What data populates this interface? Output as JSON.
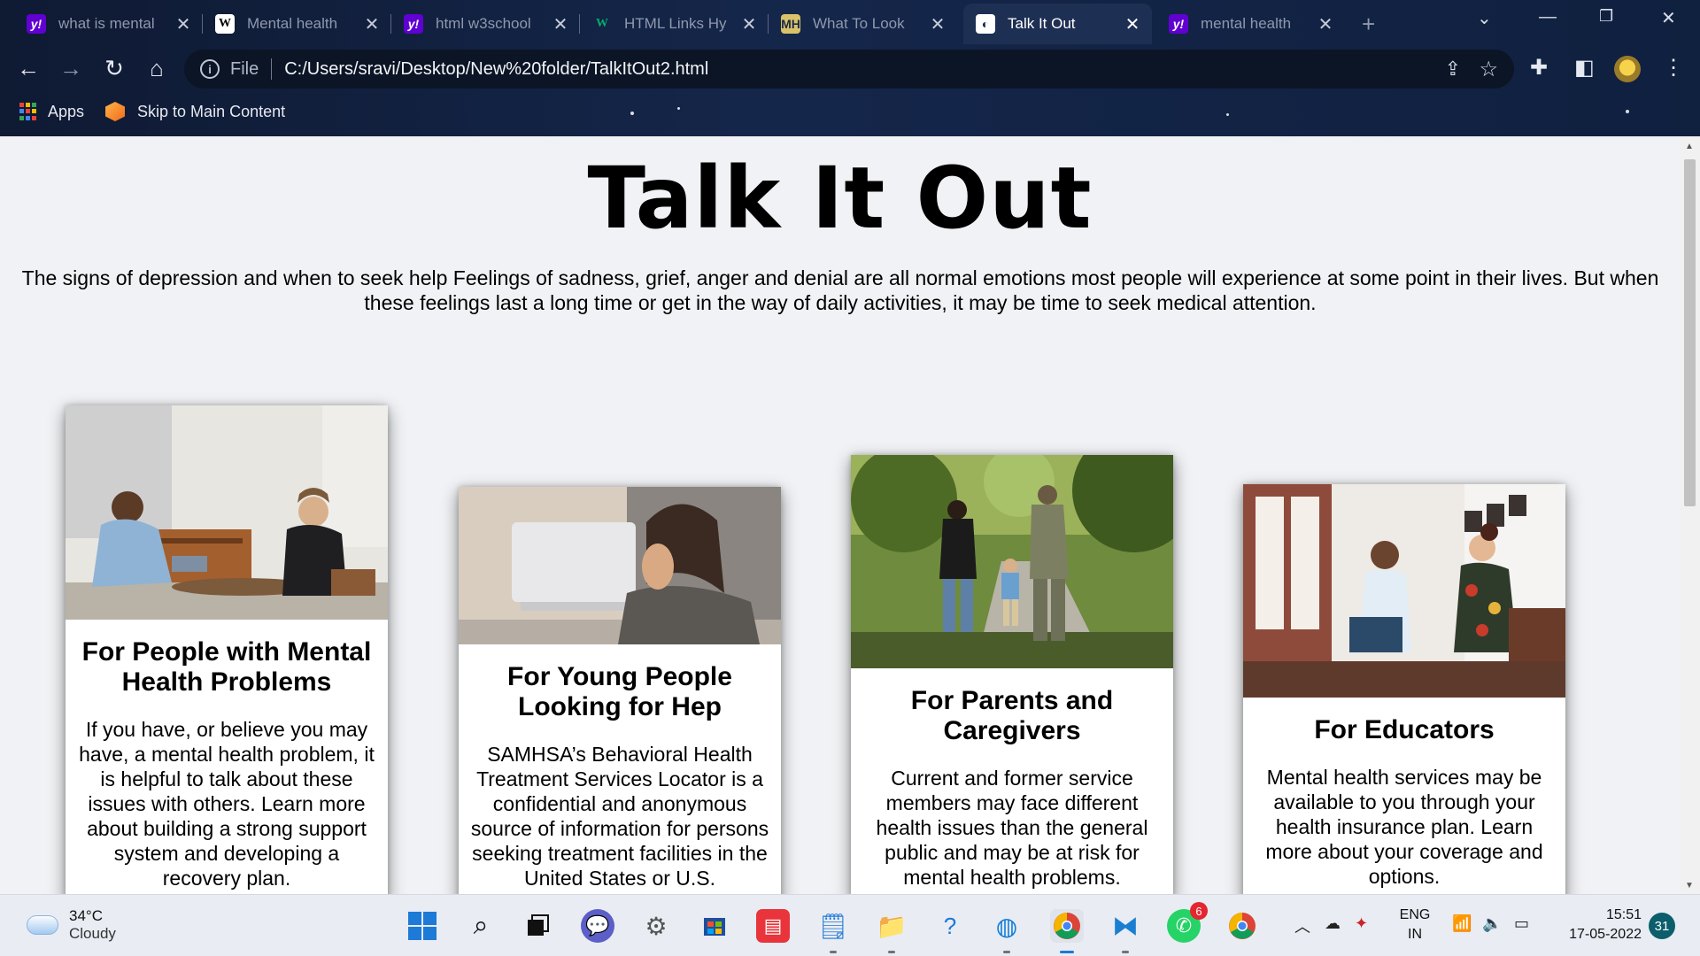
{
  "browser": {
    "tabs": [
      {
        "title": "what is mental",
        "favicon": "yahoo-icon",
        "active": false
      },
      {
        "title": "Mental health",
        "favicon": "wikipedia-icon",
        "active": false
      },
      {
        "title": "html w3school",
        "favicon": "yahoo-icon",
        "active": false
      },
      {
        "title": "HTML Links Hy",
        "favicon": "w3schools-icon",
        "active": false
      },
      {
        "title": "What To Look",
        "favicon": "mentalhealth-gov-icon",
        "active": false
      },
      {
        "title": "Talk It Out",
        "favicon": "globe-icon",
        "active": true
      },
      {
        "title": "mental health",
        "favicon": "yahoo-icon",
        "active": false
      }
    ],
    "favicon_glyphs": {
      "yahoo": "y!",
      "wiki": "W",
      "w3": "W",
      "mh": "MH",
      "globe": "◐"
    },
    "close_glyph": "✕",
    "address": {
      "scheme_label": "File",
      "url": "C:/Users/sravi/Desktop/New%20folder/TalkItOut2.html"
    },
    "bookmarks": [
      {
        "label": "Apps",
        "icon": "apps-grid-icon"
      },
      {
        "label": "Skip to Main Content",
        "icon": "orange-cube-icon"
      }
    ],
    "theme_color": "#14264a"
  },
  "page": {
    "title": "Talk It Out",
    "intro": "The signs of depression and when to seek help Feelings of sadness, grief, anger and denial are all normal emotions most people will experience at some point in their lives. But when these feelings last a long time or get in the way of daily activities, it may be time to seek medical attention.",
    "cards": [
      {
        "heading": "For People with Mental Health Problems",
        "text": "If you have, or believe you may have, a mental health problem, it is helpful to talk about these issues with others. Learn more about building a strong support system and developing a recovery plan.",
        "image": "therapy-session-photo"
      },
      {
        "heading": "For Young People Looking for Hep",
        "text": "SAMHSA’s Behavioral Health Treatment Services Locator is a confidential and anonymous source of information for persons seeking treatment facilities in the United States or U.S.",
        "image": "young-woman-laptop-photo"
      },
      {
        "heading": "For Parents and Caregivers",
        "text": "Current and former service members may face different health issues than the general public and may be at risk for mental health problems.",
        "image": "family-walking-photo"
      },
      {
        "heading": "For Educators",
        "text": "Mental health services may be available to you through your health insurance plan. Learn more about your coverage and options.",
        "image": "counselor-meeting-photo"
      }
    ]
  },
  "taskbar": {
    "weather": {
      "temp": "34°C",
      "condition": "Cloudy"
    },
    "language": {
      "line1": "ENG",
      "line2": "IN"
    },
    "clock": {
      "time": "15:51",
      "date": "17-05-2022"
    },
    "whatsapp_badge": "6",
    "notification_count": "31"
  }
}
